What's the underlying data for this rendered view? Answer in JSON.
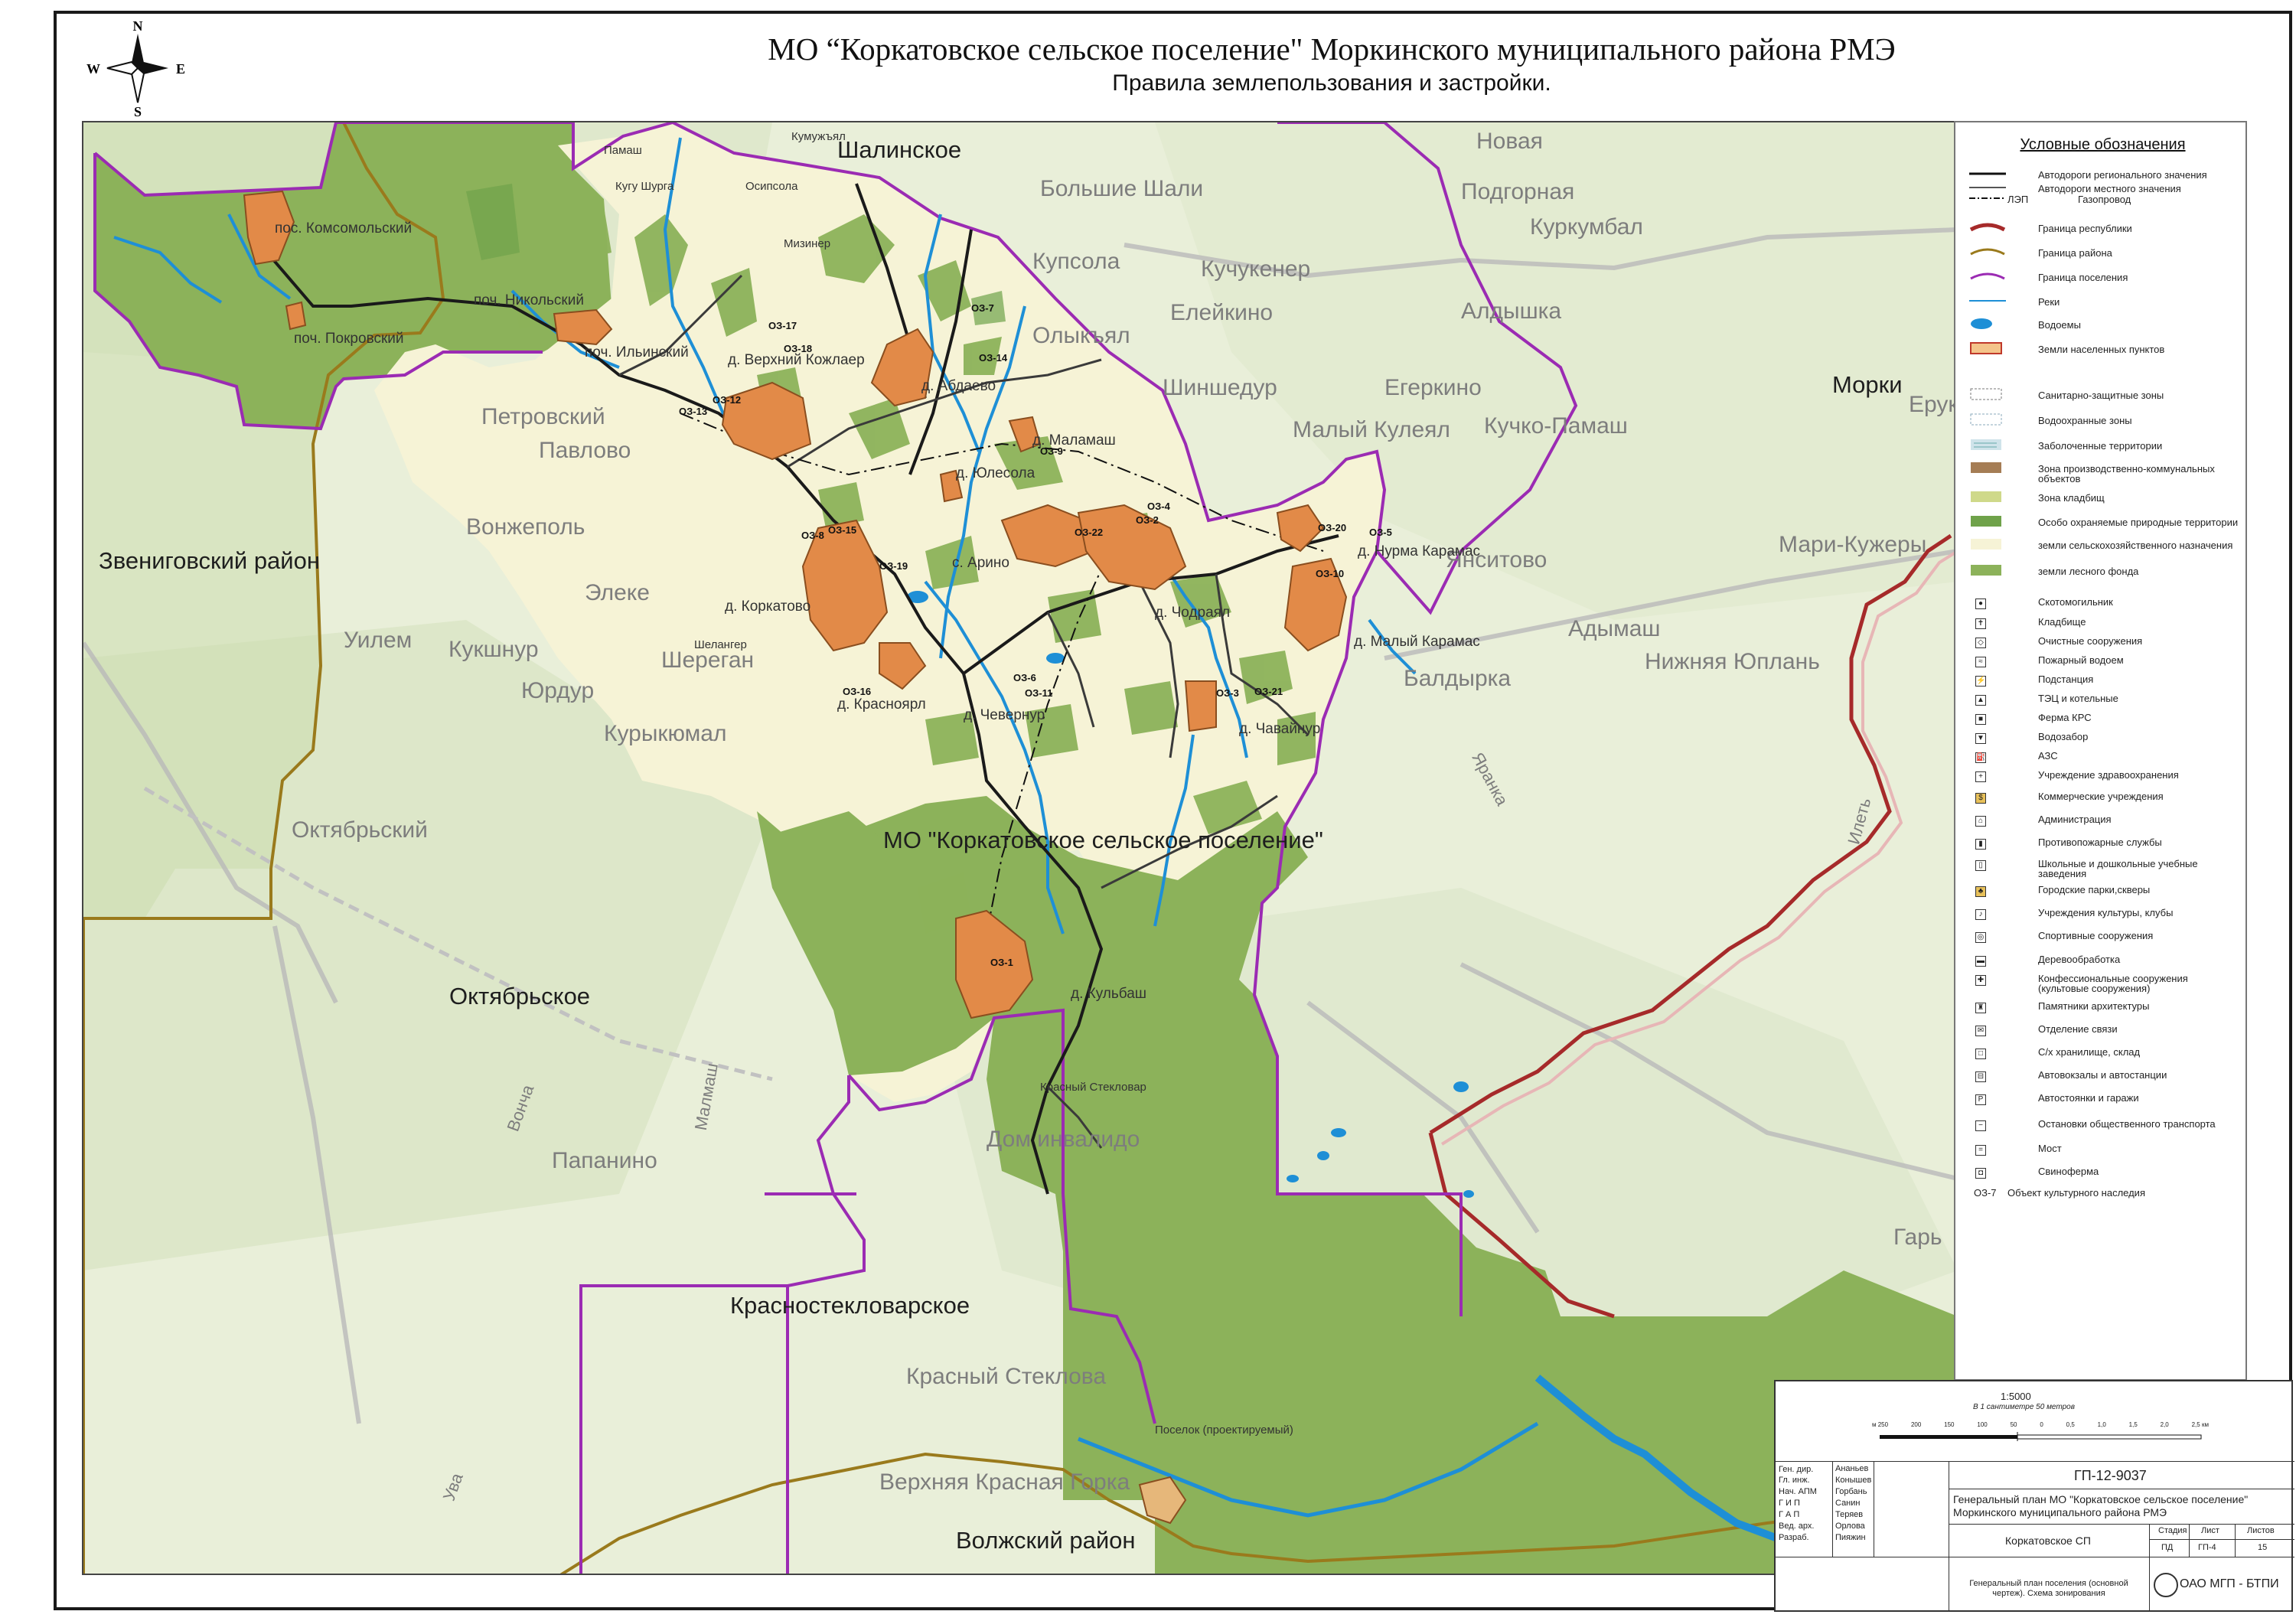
{
  "header": {
    "title": "МО “Коркатовское сельское поселение\" Моркинского муниципального района РМЭ",
    "subtitle": "Правила землепользования  и застройки."
  },
  "compass": {
    "n": "N",
    "s": "S",
    "w": "W",
    "e": "E"
  },
  "map": {
    "colors": {
      "forest": "#8cb25a",
      "settlement_boundary": "#9b2bb3",
      "republic_boundary": "#a62a2a",
      "district_boundary": "#9a7a1c",
      "agricultural": "#f7f4d9",
      "settlement": "#e28a48",
      "river": "#1e8fd6"
    },
    "places": {
      "shalinskoe": "Шалинское",
      "bolshie_shali": "Большие Шали",
      "novaya": "Новая",
      "podgornaya": "Подгорная",
      "kurkumbal": "Куркумбал",
      "kupsola": "Купсола",
      "kuchukener": "Кучукенер",
      "eleykino": "Елейкино",
      "aldyshka": "Алдышка",
      "olykyal": "Олыкъял",
      "shinshedur": "Шиншедур",
      "malyy_kuleyal": "Малый Кулеял",
      "egerkino": "Егеркино",
      "kuchko_pamash": "Кучко-Памаш",
      "morki": "Морки",
      "eruk": "Ерук",
      "petrovskiy": "Петровский",
      "pavlovo": "Павлово",
      "vonzhepol": "Вонжеполь",
      "zvenigovskiy": "Звениговский район",
      "elekeyevo": "Элеке",
      "uilem": "Уилем",
      "kukshnur": "Кукшнур",
      "sheregan": "Шереган",
      "yurdur": "Юрдур",
      "kurykyumal": "Курыкюмал",
      "oktyabrskiy": "Октябрьский",
      "oktyabrskoe": "Октябрьское",
      "papanino": "Папанино",
      "dom_invalidov": "Дом инвалидо",
      "krasnostek": "Красностекловарское",
      "krasny_steklovar": "Красный Стеклова",
      "verhnyaya_krasnaya_gorka": "Верхняя Красная Горка",
      "volzhskiy": "Волжский район",
      "mari_kuzhery": "Мари-Кужеры",
      "adymash": "Адымаш",
      "baldyrka": "Балдырка",
      "nizhnyaya_yuplan": "Нижняя Юплань",
      "yanisitovo": "Янситово",
      "gar": "Гарь",
      "mo_label": "МО \"Коркатовское сельское поселение\"",
      "komsomolskiy": "пос. Комсомольский",
      "pokrovskiy": "поч. Покровский",
      "nikolskiy": "поч. Никольский",
      "ilyinskiy": "поч. Ильинский",
      "verh_kozhlaer": "д. Верхний Кожлаер",
      "abdaevo": "д. Абдаево",
      "malamash": "д. Маламаш",
      "yulesola": "д. Юлесола",
      "arino": "с. Арино",
      "chodrayal": "д. Чодраял",
      "nurma_karamas": "д. Нурма Карамас",
      "malyy_karamas": "д. Малый Карамас",
      "chavaynur": "д. Чавайнур",
      "chevernur": "д. Чевернур",
      "krasnoyar": "д. Красноярл",
      "korkatovo": "д. Коркатово",
      "kulbash": "д. Кульбаш",
      "krasny_stek_small": "Красный Стекловар",
      "poselok_proekt": "Поселок (проектируемый)",
      "kugu_shurga": "Кугу Шурга",
      "osipsola": "Осипсола",
      "mizinier": "Мизинер",
      "kumuzhyal": "Кумужъял",
      "shelanger": "Шелангер",
      "pamash": "Памаш",
      "yaranka": "Яранка",
      "ilet": "Илеть",
      "vonja": "Вонча",
      "malmash": "Малмаш",
      "uva": "Ува"
    },
    "zones": [
      "ОЗ-1",
      "ОЗ-2",
      "ОЗ-3",
      "ОЗ-4",
      "ОЗ-5",
      "ОЗ-6",
      "ОЗ-7",
      "ОЗ-8",
      "ОЗ-9",
      "ОЗ-10",
      "ОЗ-11",
      "ОЗ-12",
      "ОЗ-13",
      "ОЗ-14",
      "ОЗ-15",
      "ОЗ-16",
      "ОЗ-17",
      "ОЗ-18",
      "ОЗ-19",
      "ОЗ-20",
      "ОЗ-21",
      "ОЗ-22"
    ]
  },
  "legend": {
    "title": "Условные обозначения",
    "items": [
      "Автодороги регионального значения",
      "Автодороги местного значения",
      "ЛЭП",
      "Газопровод",
      "Граница республики",
      "Граница района",
      "Граница поселения",
      "Реки",
      "Водоемы",
      "Земли населенных пунктов",
      "Санитарно-защитные зоны",
      "Водоохранные зоны",
      "Заболоченные территории",
      "Зона производственно-коммунальных объектов",
      "Зона кладбищ",
      "Особо охраняемые природные территории",
      "земли сельскохозяйственного назначения",
      "земли лесного фонда",
      "Скотомогильник",
      "Кладбище",
      "Очистные сооружения",
      "Пожарный водоем",
      "Подстанция",
      "ТЭЦ и котельные",
      "Ферма КРС",
      "Водозабор",
      "АЗС",
      "Учреждение здравоохранения",
      "Коммерческие учреждения",
      "Администрация",
      "Противопожарные службы",
      "Школьные и дошкольные учебные заведения",
      "Городские парки,скверы",
      "Учреждения культуры, клубы",
      "Спортивные сооружения",
      "Деревообработка",
      "Конфессиональные сооружения (культовые сооружения)",
      "Памятники архитектуры",
      "Отделение связи",
      "С/х хранилище, склад",
      "Автовокзалы и автостанции",
      "Автостоянки и гаражи",
      "Остановки общественного транспорта",
      "Мост",
      "Свиноферма",
      "Объект культурного наследия"
    ],
    "oz_label": "ОЗ-7"
  },
  "scale": {
    "ratio": "1:5000",
    "note": "В 1 сантиметре 50 метров",
    "ticks": [
      "м 250",
      "200",
      "150",
      "100",
      "50",
      "0",
      "0,5",
      "1,0",
      "1,5",
      "2,0",
      "2,5 км"
    ]
  },
  "stamp": {
    "code": "ГП-12-9037",
    "description": "Генеральный план МО \"Коркатовское сельское поселение\" Моркинского муниципального района РМЭ",
    "object": "Коркатовское СП",
    "sheet_title": "Генеральный план поселения (основной чертеж). Схема зонирования",
    "company": "ОАО МГП - БТПИ",
    "headers": [
      "Стадия",
      "Лист",
      "Листов"
    ],
    "values": [
      "ПД",
      "ГП-4",
      "15"
    ],
    "roles": [
      "Ген. дир.",
      "Гл. инж.",
      "Нач. АПМ",
      "Г И П",
      "Г А П",
      "Вед. арх.",
      "Разраб."
    ],
    "names": [
      "Ананьев",
      "Конышев",
      "Горбань",
      "Санин",
      "Теряев",
      "Орлова",
      "Пияжин"
    ]
  }
}
